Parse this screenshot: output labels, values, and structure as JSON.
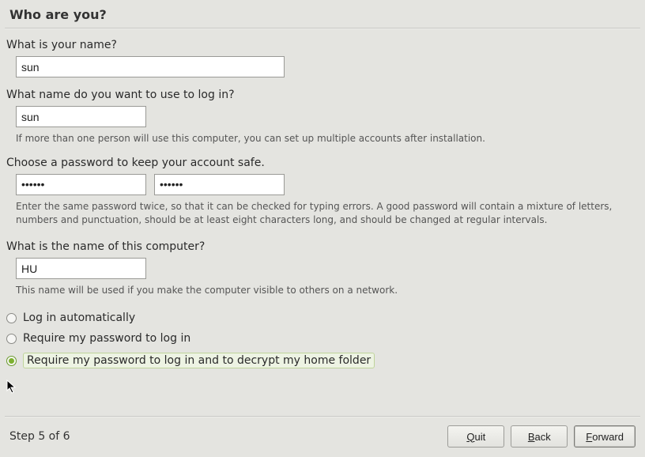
{
  "header": {
    "title": "Who are you?"
  },
  "fields": {
    "name": {
      "label": "What is your name?",
      "value": "sun"
    },
    "username": {
      "label": "What name do you want to use to log in?",
      "value": "sun",
      "hint": "If more than one person will use this computer, you can set up multiple accounts after installation."
    },
    "password": {
      "label": "Choose a password to keep your account safe.",
      "value1": "••••••",
      "value2": "••••••",
      "hint": "Enter the same password twice, so that it can be checked for typing errors. A good password will contain a mixture of letters, numbers and punctuation, should be at least eight characters long, and should be changed at regular intervals."
    },
    "computer": {
      "label": "What is the name of this computer?",
      "value": "HU",
      "hint": "This name will be used if you make the computer visible to others on a network."
    }
  },
  "login_options": {
    "selected": 2,
    "items": [
      "Log in automatically",
      "Require my password to log in",
      "Require my password to log in and to decrypt my home folder"
    ]
  },
  "footer": {
    "step": "Step 5 of 6",
    "quit": "Quit",
    "back": "Back",
    "forward": "Forward"
  }
}
